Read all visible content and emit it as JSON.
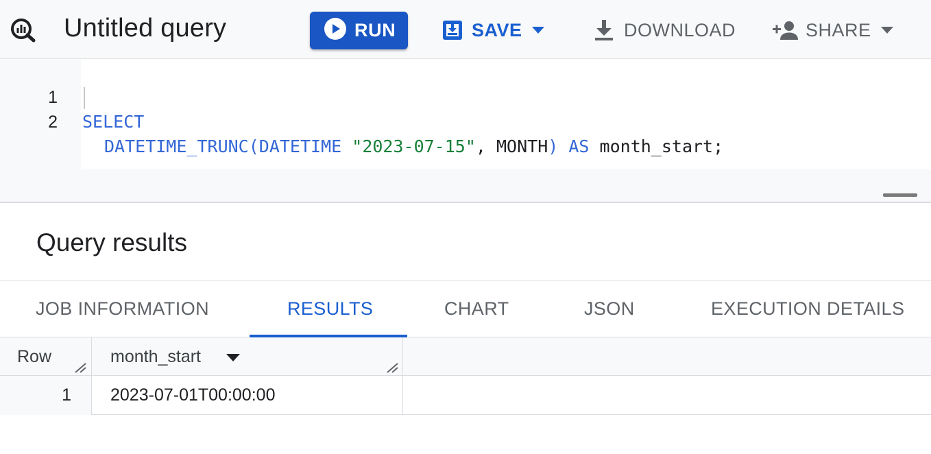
{
  "toolbar": {
    "title": "Untitled query",
    "run_label": "RUN",
    "save_label": "SAVE",
    "download_label": "DOWNLOAD",
    "share_label": "SHARE"
  },
  "editor": {
    "lines": [
      {
        "number": "1",
        "tokens": [
          {
            "text": "SELECT",
            "kind": "keyword"
          }
        ]
      },
      {
        "number": "2",
        "tokens": [
          {
            "text": "DATETIME_TRUNC(",
            "kind": "keyword"
          },
          {
            "text": "DATETIME",
            "kind": "keyword"
          },
          {
            "text": " ",
            "kind": "identifier"
          },
          {
            "text": "\"2023-07-15\"",
            "kind": "string"
          },
          {
            "text": ", MONTH",
            "kind": "identifier"
          },
          {
            "text": ")",
            "kind": "keyword"
          },
          {
            "text": " ",
            "kind": "identifier"
          },
          {
            "text": "AS",
            "kind": "keyword"
          },
          {
            "text": " month_start;",
            "kind": "identifier"
          }
        ]
      }
    ]
  },
  "results": {
    "title": "Query results",
    "tabs": [
      {
        "label": "JOB INFORMATION",
        "active": false
      },
      {
        "label": "RESULTS",
        "active": true
      },
      {
        "label": "CHART",
        "active": false
      },
      {
        "label": "JSON",
        "active": false
      },
      {
        "label": "EXECUTION DETAILS",
        "active": false
      }
    ],
    "table": {
      "headers": [
        "Row",
        "month_start"
      ],
      "rows": [
        {
          "row": "1",
          "month_start": "2023-07-01T00:00:00"
        }
      ]
    }
  },
  "colors": {
    "run_button": "#1a56c4",
    "accent": "#1a5fd0",
    "keyword": "#3367d6",
    "string": "#188038",
    "toolbar_bg": "#f8f9fa"
  },
  "icons": {
    "logo": "bigquery-logo-icon",
    "run": "play-circle-icon",
    "save": "save-icon",
    "download": "download-icon",
    "share": "person-add-icon",
    "dropdown": "caret-down-icon"
  }
}
